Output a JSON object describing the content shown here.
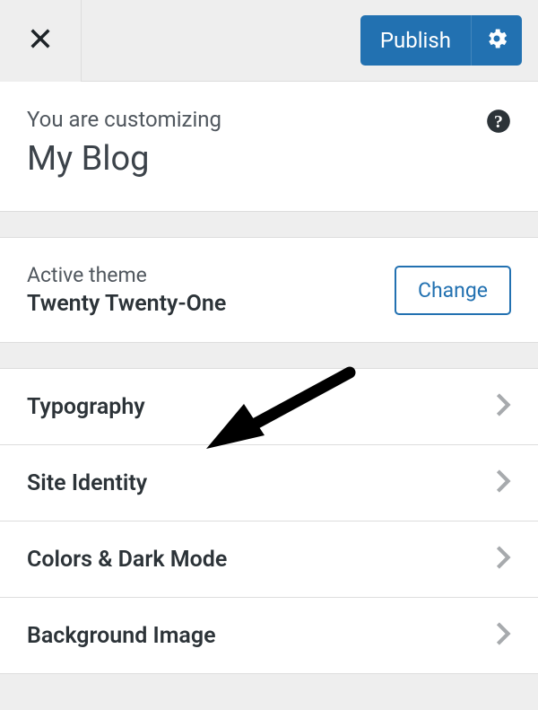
{
  "header": {
    "publish_label": "Publish"
  },
  "customizing": {
    "label": "You are customizing",
    "site_title": "My Blog"
  },
  "theme": {
    "label": "Active theme",
    "name": "Twenty Twenty-One",
    "change_label": "Change"
  },
  "menu": {
    "items": [
      {
        "label": "Typography"
      },
      {
        "label": "Site Identity"
      },
      {
        "label": "Colors & Dark Mode"
      },
      {
        "label": "Background Image"
      }
    ]
  }
}
